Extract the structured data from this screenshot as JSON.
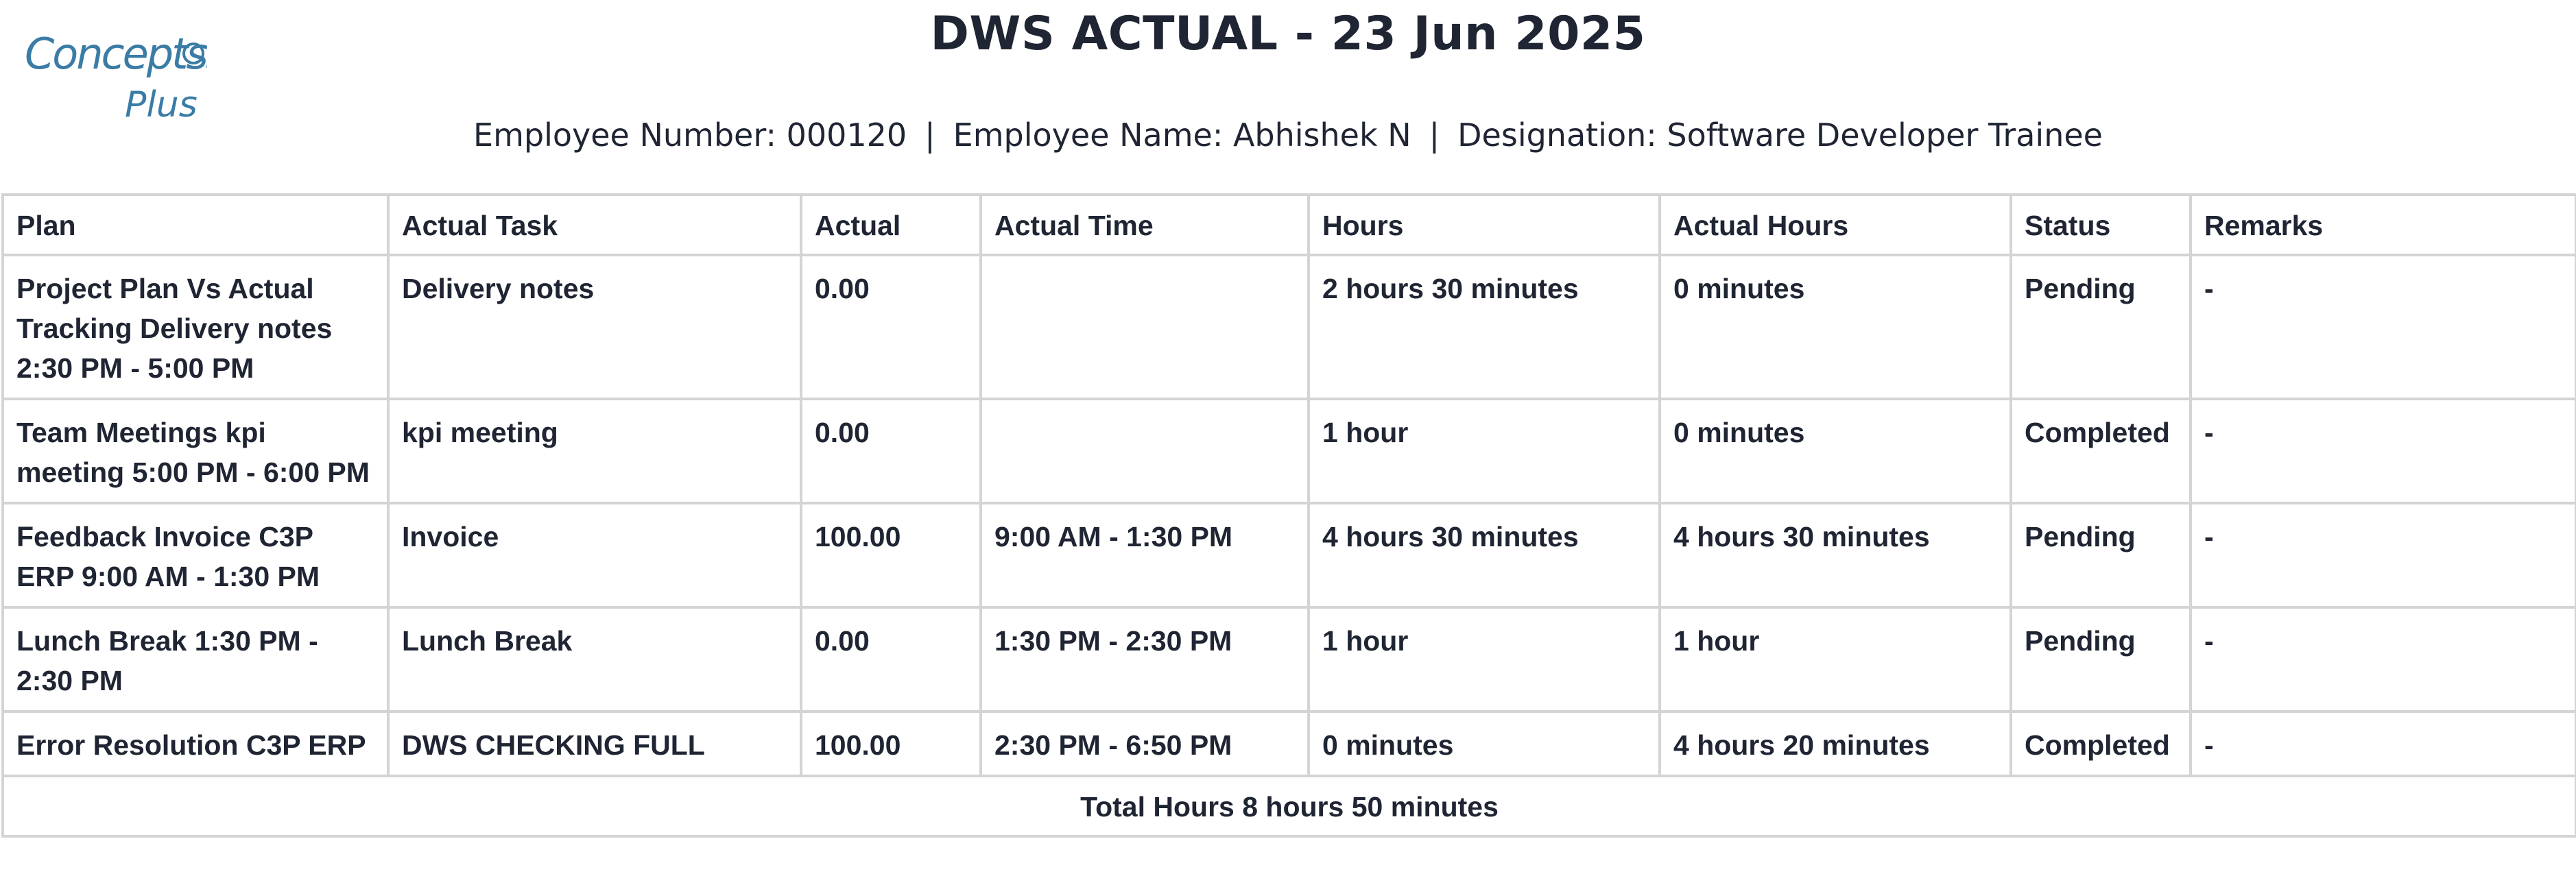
{
  "header": {
    "logo_text_main": "Concepts360",
    "logo_text_sub": "Plus",
    "title": "DWS ACTUAL - 23 Jun 2025",
    "employee_number": "Employee Number: 000120",
    "employee_name": "Employee Name: Abhishek N",
    "designation": "Designation: Software Developer Trainee",
    "separator": "|"
  },
  "table": {
    "columns": [
      "Plan",
      "Actual Task",
      "Actual",
      "Actual Time",
      "Hours",
      "Actual Hours",
      "Status",
      "Remarks"
    ],
    "rows": [
      [
        "Project Plan Vs Actual Tracking Delivery notes 2:30 PM - 5:00 PM",
        "Delivery notes",
        "0.00",
        "",
        "2 hours 30 minutes",
        "0 minutes",
        "Pending",
        "-"
      ],
      [
        "Team Meetings kpi meeting 5:00 PM - 6:00 PM",
        "kpi meeting",
        "0.00",
        "",
        "1 hour",
        "0 minutes",
        "Completed",
        "-"
      ],
      [
        "Feedback Invoice C3P ERP 9:00 AM - 1:30 PM",
        "Invoice",
        "100.00",
        "9:00 AM - 1:30 PM",
        "4 hours 30 minutes",
        "4 hours 30 minutes",
        "Pending",
        "-"
      ],
      [
        "Lunch Break 1:30 PM - 2:30 PM",
        "Lunch Break",
        "0.00",
        "1:30 PM - 2:30 PM",
        "1 hour",
        "1 hour",
        "Pending",
        "-"
      ],
      [
        "Error Resolution C3P ERP",
        "DWS CHECKING FULL",
        "100.00",
        "2:30 PM - 6:50 PM",
        "0 minutes",
        "4 hours 20 minutes",
        "Completed",
        "-"
      ]
    ],
    "total": "Total Hours 8 hours 50 minutes"
  },
  "colors": {
    "text": "#1f2533",
    "border": "#d4d4d4",
    "logo_primary": "#3a7ca5"
  }
}
